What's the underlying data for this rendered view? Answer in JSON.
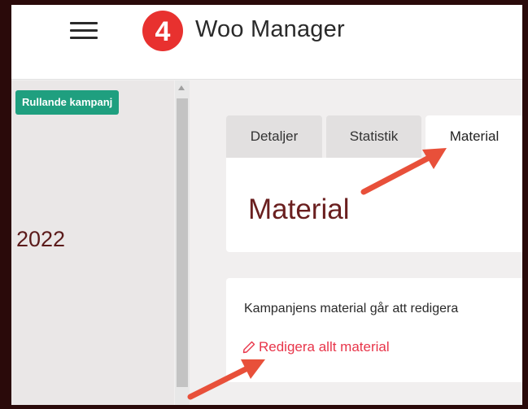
{
  "header": {
    "app_name": "Woo Manager",
    "logo_text": "4"
  },
  "sidebar": {
    "campaign_badge": "Rullande kampanj",
    "year": "2022"
  },
  "tabs": [
    {
      "label": "Detaljer",
      "active": false
    },
    {
      "label": "Statistik",
      "active": false
    },
    {
      "label": "Material",
      "active": true
    }
  ],
  "material_card": {
    "title": "Material"
  },
  "edit_card": {
    "description": "Kampanjens material går att redigera",
    "edit_link": "Redigera allt material"
  },
  "colors": {
    "badge": "#1f9f7f",
    "title": "#6a1f1f",
    "link": "#e8354a",
    "annotation_arrow": "#e8503a",
    "logo": "#e8312f"
  },
  "icons": {
    "menu": "hamburger-icon",
    "edit": "pencil-icon"
  }
}
